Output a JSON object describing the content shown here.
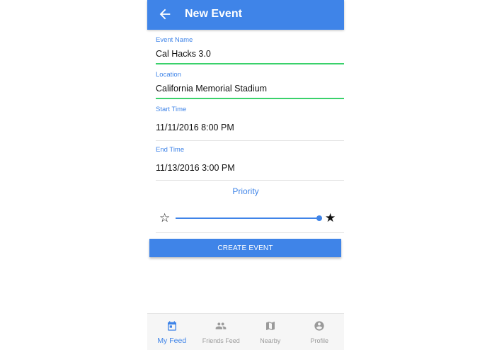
{
  "appbar": {
    "title": "New Event",
    "back_icon": "arrow-left-icon",
    "color": "#3f84e8"
  },
  "form": {
    "event_name": {
      "label": "Event Name",
      "value": "Cal Hacks 3.0"
    },
    "location": {
      "label": "Location",
      "value": "California Memorial Stadium"
    },
    "start_time": {
      "label": "Start Time",
      "value": "11/11/2016 8:00 PM"
    },
    "end_time": {
      "label": "End Time",
      "value": "11/13/2016 3:00 PM"
    },
    "priority": {
      "label": "Priority",
      "min_icon": "star-outline-icon",
      "max_icon": "star-filled-icon",
      "min_glyph": "☆",
      "max_glyph": "★",
      "level": 1.0
    },
    "submit_label": "CREATE EVENT"
  },
  "colors": {
    "accent": "#3f84e8",
    "valid_underline": "#3ad16b",
    "divider": "#e2e2e2",
    "inactive_tab": "#9a9a9a"
  },
  "tabbar": {
    "tabs": [
      {
        "label": "My Feed",
        "icon": "calendar-icon",
        "active": true
      },
      {
        "label": "Friends Feed",
        "icon": "people-icon",
        "active": false
      },
      {
        "label": "Nearby",
        "icon": "map-icon",
        "active": false
      },
      {
        "label": "Profile",
        "icon": "account-circle-icon",
        "active": false
      }
    ]
  }
}
